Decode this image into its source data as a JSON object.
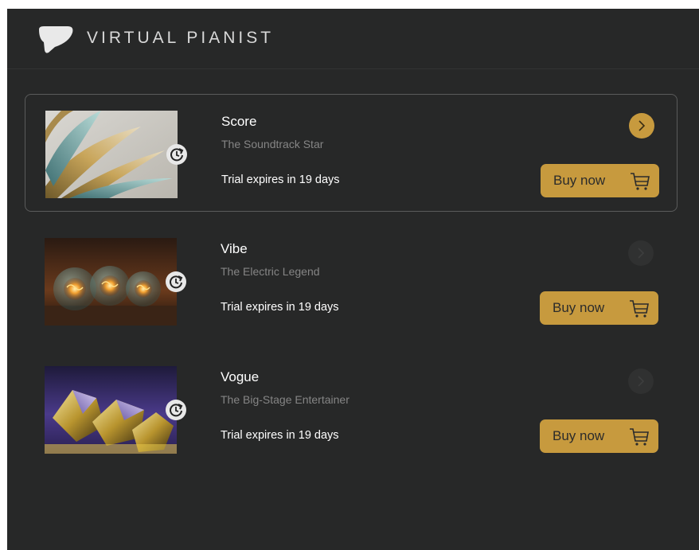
{
  "app": {
    "brand": "VIRTUAL PIANIST",
    "logo_icon": "piano-logo-icon"
  },
  "colors": {
    "background": "#272828",
    "accent": "#c79a3e",
    "muted_text": "#858585"
  },
  "products": [
    {
      "name": "Score",
      "subtitle": "The Soundtrack Star",
      "trial": "Trial expires in 19 days",
      "buy_label": "Buy now",
      "selected": true,
      "arrow_active": true,
      "image": "gold-petals-image"
    },
    {
      "name": "Vibe",
      "subtitle": "The Electric Legend",
      "trial": "Trial expires in 19 days",
      "buy_label": "Buy now",
      "selected": false,
      "arrow_active": false,
      "image": "glowing-bulbs-image"
    },
    {
      "name": "Vogue",
      "subtitle": "The Big-Stage Entertainer",
      "trial": "Trial expires in 19 days",
      "buy_label": "Buy now",
      "selected": false,
      "arrow_active": false,
      "image": "crystal-gems-image"
    }
  ]
}
